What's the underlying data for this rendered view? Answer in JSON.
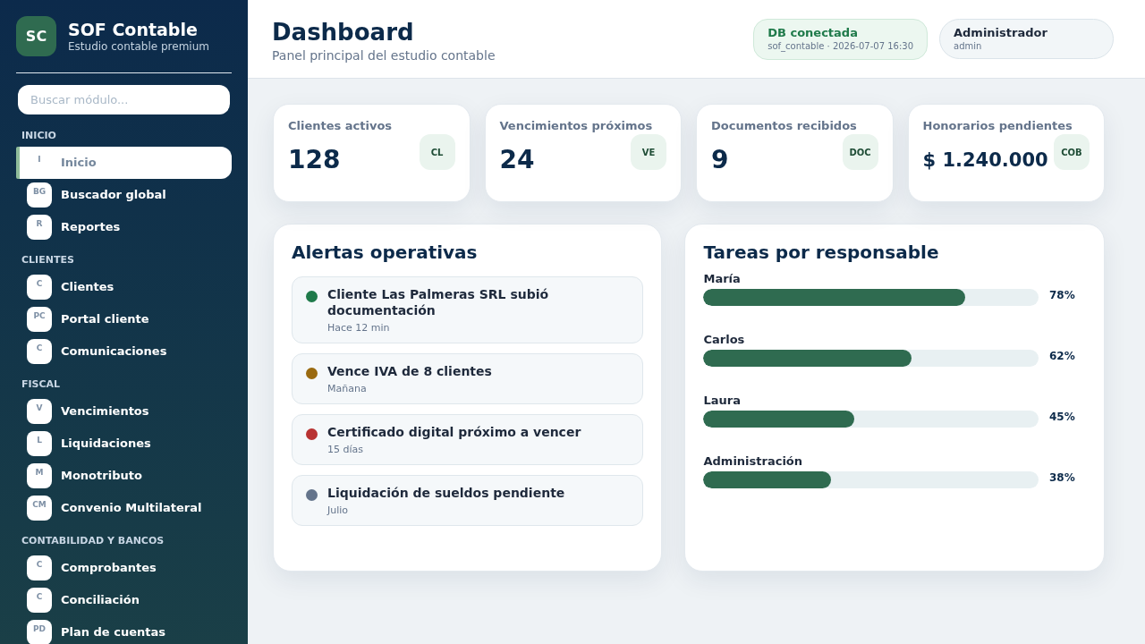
{
  "sidebar": {
    "logo_text": "SC",
    "title": "SOF Contable",
    "subtitle": "Estudio contable premium",
    "search": {
      "placeholder": "Buscar módulo..."
    },
    "sections": [
      {
        "heading": "INICIO",
        "items": [
          {
            "initials": "I",
            "label": "Inicio",
            "selected": true
          },
          {
            "initials": "BG",
            "label": "Buscador global",
            "selected": false
          },
          {
            "initials": "R",
            "label": "Reportes",
            "selected": false
          }
        ]
      },
      {
        "heading": "CLIENTES",
        "items": [
          {
            "initials": "C",
            "label": "Clientes",
            "selected": false
          },
          {
            "initials": "PC",
            "label": "Portal cliente",
            "selected": false
          },
          {
            "initials": "C",
            "label": "Comunicaciones",
            "selected": false
          }
        ]
      },
      {
        "heading": "FISCAL",
        "items": [
          {
            "initials": "V",
            "label": "Vencimientos",
            "selected": false
          },
          {
            "initials": "L",
            "label": "Liquidaciones",
            "selected": false
          },
          {
            "initials": "M",
            "label": "Monotributo",
            "selected": false
          },
          {
            "initials": "CM",
            "label": "Convenio Multilateral",
            "selected": false
          }
        ]
      },
      {
        "heading": "CONTABILIDAD Y BANCOS",
        "items": [
          {
            "initials": "C",
            "label": "Comprobantes",
            "selected": false
          },
          {
            "initials": "C",
            "label": "Conciliación",
            "selected": false
          },
          {
            "initials": "PD",
            "label": "Plan de cuentas",
            "selected": false
          }
        ]
      }
    ]
  },
  "header": {
    "title": "Dashboard",
    "subtitle": "Panel principal del estudio contable",
    "db_status": {
      "label": "DB conectada",
      "detail": "sof_contable · 2026-07-07 16:30"
    },
    "user": {
      "name": "Administrador",
      "role": "admin"
    }
  },
  "stats": [
    {
      "label": "Clientes activos",
      "value": "128",
      "badge": "CL"
    },
    {
      "label": "Vencimientos próximos",
      "value": "24",
      "badge": "VE"
    },
    {
      "label": "Documentos recibidos",
      "value": "9",
      "badge": "DOC"
    },
    {
      "label": "Honorarios pendientes",
      "value": "$ 1.240.000",
      "badge": "COB"
    }
  ],
  "alerts": {
    "title": "Alertas operativas",
    "items": [
      {
        "title": "Cliente Las Palmeras SRL subió documentación",
        "time": "Hace 12 min",
        "color": "#1f7a4a"
      },
      {
        "title": "Vence IVA de 8 clientes",
        "time": "Mañana",
        "color": "#9a6a10"
      },
      {
        "title": "Certificado digital próximo a vencer",
        "time": "15 días",
        "color": "#b83232"
      },
      {
        "title": "Liquidación de sueldos pendiente",
        "time": "Julio",
        "color": "#64748b"
      }
    ]
  },
  "tasks": {
    "title": "Tareas por responsable",
    "rows": [
      {
        "name": "María",
        "level": 0.78,
        "reading": "78%"
      },
      {
        "name": "Carlos",
        "level": 0.62,
        "reading": "62%"
      },
      {
        "name": "Laura",
        "level": 0.45,
        "reading": "45%"
      },
      {
        "name": "Administración",
        "level": 0.38,
        "reading": "38%"
      }
    ]
  }
}
